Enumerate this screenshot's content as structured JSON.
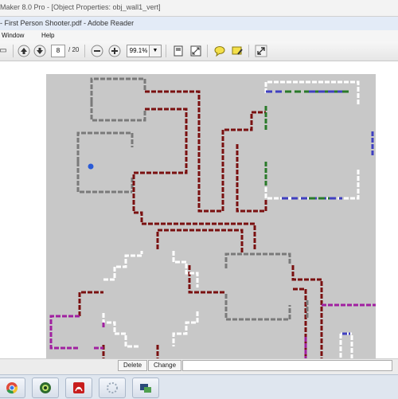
{
  "window": {
    "app_title": "Maker 8.0 Pro - [Object Properties: obj_wall1_vert]",
    "reader_title": "- First Person Shooter.pdf - Adobe Reader"
  },
  "menu": {
    "items": [
      "Window",
      "Help"
    ]
  },
  "toolbar": {
    "page_current": "8",
    "page_total": "/ 20",
    "zoom": "99.1%"
  },
  "bottom_bar": {
    "delete_label": "Delete",
    "change_label": "Change"
  },
  "icons": {
    "back": "save-icon",
    "prev": "arrow-up-icon",
    "next": "arrow-down-icon",
    "zoom_out": "minus-icon",
    "zoom_in": "plus-icon",
    "fit_page": "fit-page-icon",
    "fit_width": "fit-width-icon",
    "comment": "comment-icon",
    "highlight": "highlight-icon",
    "expand": "expand-icon"
  },
  "colors": {
    "wall_dark_red": "#7a1010",
    "wall_gray": "#7a7a7a",
    "wall_white": "#ffffff",
    "wall_green": "#2a7a2a",
    "wall_blue": "#4040c0",
    "wall_purple": "#a020a0",
    "player": "#2a5bd7",
    "canvas_bg": "#c8c8c8"
  }
}
